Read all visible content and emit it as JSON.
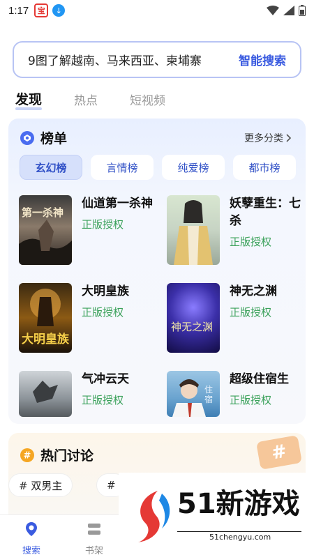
{
  "status_bar": {
    "time": "1:17",
    "app_badge": "宝",
    "download_badge": "↓"
  },
  "search": {
    "hint": "9图了解越南、马来西亚、柬埔寨",
    "action_label": "智能搜索"
  },
  "top_tabs": [
    {
      "label": "发现",
      "active": true
    },
    {
      "label": "热点",
      "active": false
    },
    {
      "label": "短视频",
      "active": false
    }
  ],
  "ranking": {
    "title": "榜单",
    "more_label": "更多分类",
    "categories": [
      {
        "label": "玄幻榜",
        "active": true
      },
      {
        "label": "言情榜",
        "active": false
      },
      {
        "label": "纯爱榜",
        "active": false
      },
      {
        "label": "都市榜",
        "active": false
      }
    ],
    "books": [
      {
        "title": "仙道第一杀神",
        "tag": "正版授权",
        "cover_text": "第一杀神"
      },
      {
        "title": "妖孽重生：七杀",
        "tag": "正版授权",
        "cover_text": ""
      },
      {
        "title": "大明皇族",
        "tag": "正版授权",
        "cover_text": "大明皇族"
      },
      {
        "title": "神无之渊",
        "tag": "正版授权",
        "cover_text": "神无之渊"
      },
      {
        "title": "气冲云天",
        "tag": "正版授权",
        "cover_text": ""
      },
      {
        "title": "超级住宿生",
        "tag": "正版授权",
        "cover_text": "住宿"
      }
    ]
  },
  "hot": {
    "title": "热门讨论",
    "topics": [
      "# 双男主",
      "#"
    ]
  },
  "bottom_nav": [
    {
      "label": "搜索",
      "active": true
    },
    {
      "label": "书架",
      "active": false
    }
  ],
  "watermark": {
    "text": "51新游戏",
    "url": "51chengyu.com"
  },
  "colors": {
    "accent": "#3a5be0",
    "tag_green": "#3aa15a"
  }
}
